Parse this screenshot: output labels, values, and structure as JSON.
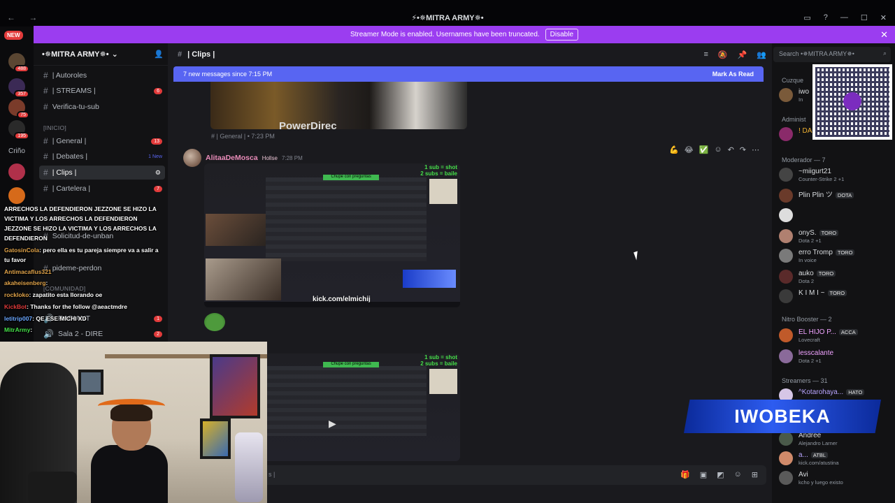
{
  "window": {
    "title": "⚡•✵MITRA ARMY✵•",
    "nav": "← →"
  },
  "banner": {
    "text": "Streamer Mode is enabled. Usernames have been truncated.",
    "disable": "Disable"
  },
  "rail": {
    "new_label": "NEW",
    "badges": [
      "488",
      "357",
      "75",
      "195"
    ],
    "crino": "Criño"
  },
  "server": {
    "name": "•✵MITRA ARMY✵•"
  },
  "channels": [
    {
      "name": "| Autoroles",
      "count": ""
    },
    {
      "name": "| STREAMS |",
      "count": "6"
    },
    {
      "name": "Verifica-tu-sub",
      "count": ""
    },
    {
      "name": "| General |",
      "count": "13"
    },
    {
      "name": "| Debates |",
      "count": "1 New"
    },
    {
      "name": "| Clips |",
      "count": ""
    },
    {
      "name": "| Cartelera |",
      "count": "7"
    },
    {
      "name": "Solicitud-de-unban",
      "count": ""
    },
    {
      "name": "pideme-perdon",
      "count": ""
    },
    {
      "name": "RADIANT",
      "count": "1"
    },
    {
      "name": "Sala 2 - DIRE",
      "count": "2"
    }
  ],
  "categories": {
    "inicio": "[INICIO]",
    "comunidad": "[COMUNIDAD]"
  },
  "overlay": [
    {
      "user": "",
      "text": "ARRECHOS LA DEFENDIERON  JEZZONE SE HIZO LA"
    },
    {
      "user": "",
      "text": "VICTIMA Y LOS ARRECHOS LA DEFENDIERON"
    },
    {
      "user": "",
      "text": "JEZZONE SE HIZO LA VICTIMA Y LOS ARRECHOS LA"
    },
    {
      "user": "",
      "text": "DEFENDIERON"
    },
    {
      "user": "GatosinCola",
      "text": ": pero ella es tu pareja siempre va a salir a"
    },
    {
      "user": "",
      "text": "tu favor"
    },
    {
      "user": "Antimacaflus321",
      "text": ""
    },
    {
      "user": "akaheisenberg",
      "text": ":"
    },
    {
      "user": "rockloko",
      "text": ": zapatito esta llorando oe"
    },
    {
      "user": "KickBot",
      "text": ": Thanks for the follow @aeactmdre"
    },
    {
      "user": "letitrip007",
      "text": ": QE ESE MICHI XD"
    },
    {
      "user": "MitrArmy",
      "text": ":"
    }
  ],
  "channel_header": {
    "name": "| Clips |"
  },
  "new_messages": {
    "text": "7 new messages since 7:15 PM",
    "mark": "Mark As Read"
  },
  "message1": {
    "image_text": "PowerDirec",
    "meta": "# | General | • 7:23 PM"
  },
  "message2": {
    "author": "AlitaaDeMosca",
    "role": "Hollse",
    "time": "7:28 PM",
    "subs_line1": "1 sub = shot",
    "subs_line2": "2 subs = baile",
    "kick_url": "kick.com/elmichij",
    "stream_title": "Chupe con preguntas"
  },
  "composer": {
    "channel": "s |"
  },
  "search": {
    "placeholder": "Search •✵MITRA ARMY✵•"
  },
  "members": {
    "groups": [
      {
        "label": "Cuzque"
      },
      {
        "label": "Administ"
      },
      {
        "label": "Moderador — 7"
      },
      {
        "label": "Nitro Booster — 2"
      },
      {
        "label": "Streamers — 31"
      }
    ],
    "list": [
      {
        "name": "iwo",
        "sub": "In",
        "tag": ""
      },
      {
        "name": "! DA",
        "sub": "",
        "tag": ""
      },
      {
        "name": "~miigurt21",
        "sub": "Counter-Strike 2 +1",
        "tag": ""
      },
      {
        "name": "Plin Plin ツ",
        "sub": "",
        "tag": "DOTA"
      },
      {
        "name": "",
        "sub": "",
        "tag": ""
      },
      {
        "name": "onyS.",
        "sub": "Dota 2 +1",
        "tag": "TORO"
      },
      {
        "name": "erro Tromp",
        "sub": "In voice",
        "tag": "TORO"
      },
      {
        "name": "auko",
        "sub": "Dota 2",
        "tag": "TORO"
      },
      {
        "name": "K I M I ~",
        "sub": "",
        "tag": "TORO"
      },
      {
        "name": "EL HIJO P...",
        "sub": "Lovecraft",
        "tag": "ACCA"
      },
      {
        "name": "lesscalante",
        "sub": "Dota 2 +1",
        "tag": ""
      },
      {
        "name": "^Kotarohaya...",
        "sub": "",
        "tag": "HATO"
      },
      {
        "name": "Andree",
        "sub": "Alejandro Larner",
        "tag": ""
      },
      {
        "name": "a...",
        "sub": "kick.com/atustina",
        "tag": "ATBL"
      },
      {
        "name": "Avi",
        "sub": "kcho y luego existo",
        "tag": ""
      }
    ]
  },
  "iwobeka": "IWOBEKA",
  "colors": {
    "brand": "#5865f2",
    "banner": "#9b3df0",
    "bg": "#1a1a1e",
    "sidebar": "#121214",
    "danger": "#e23b3b"
  }
}
